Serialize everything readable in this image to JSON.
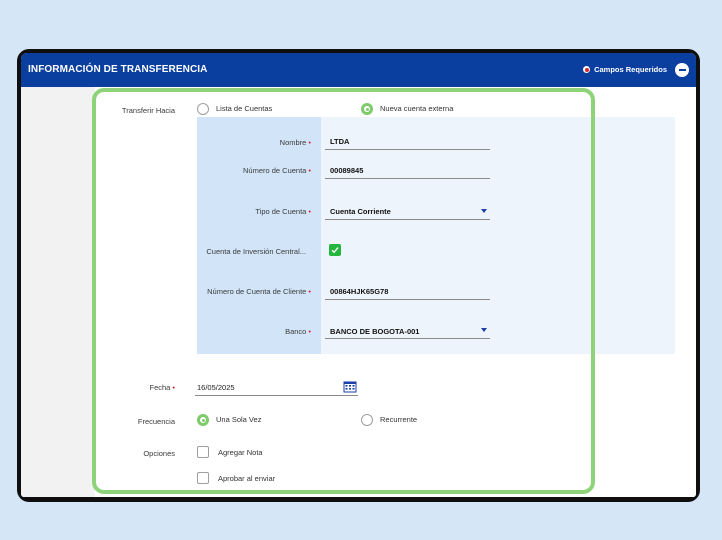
{
  "header": {
    "title": "INFORMACIÓN DE TRANSFERENCIA",
    "required_label": "Campos Requeridos"
  },
  "transfer_to": {
    "label": "Transferir Hacia",
    "options": [
      "Lista de Cuentas",
      "Nueva cuenta externa"
    ],
    "selected": "Nueva cuenta externa"
  },
  "external_account": {
    "nombre": {
      "label": "Nombre",
      "value": "LTDA"
    },
    "numero_cuenta": {
      "label": "Número de Cuenta",
      "value": "00089845"
    },
    "tipo_cuenta": {
      "label": "Tipo de Cuenta",
      "value": "Cuenta Corriente"
    },
    "inversion": {
      "label": "Cuenta de Inversión Central...",
      "checked": true
    },
    "numero_cliente": {
      "label": "Número de Cuenta de Cliente",
      "value": "00864HJK65G78"
    },
    "banco": {
      "label": "Banco",
      "value": "BANCO DE BOGOTA-001"
    }
  },
  "fecha": {
    "label": "Fecha",
    "value": "16/05/2025"
  },
  "frecuencia": {
    "label": "Frecuencia",
    "options": [
      "Una Sola Vez",
      "Recurrente"
    ],
    "selected": "Una Sola Vez"
  },
  "opciones": {
    "label": "Opciones",
    "items": [
      "Agregar Nota",
      "Aprobar al enviar"
    ]
  },
  "colors": {
    "header_bg": "#0a3f9f",
    "accent_green": "#7dcb6b",
    "required_red": "#d9262e",
    "label_col_bg": "#d2e5f8"
  }
}
